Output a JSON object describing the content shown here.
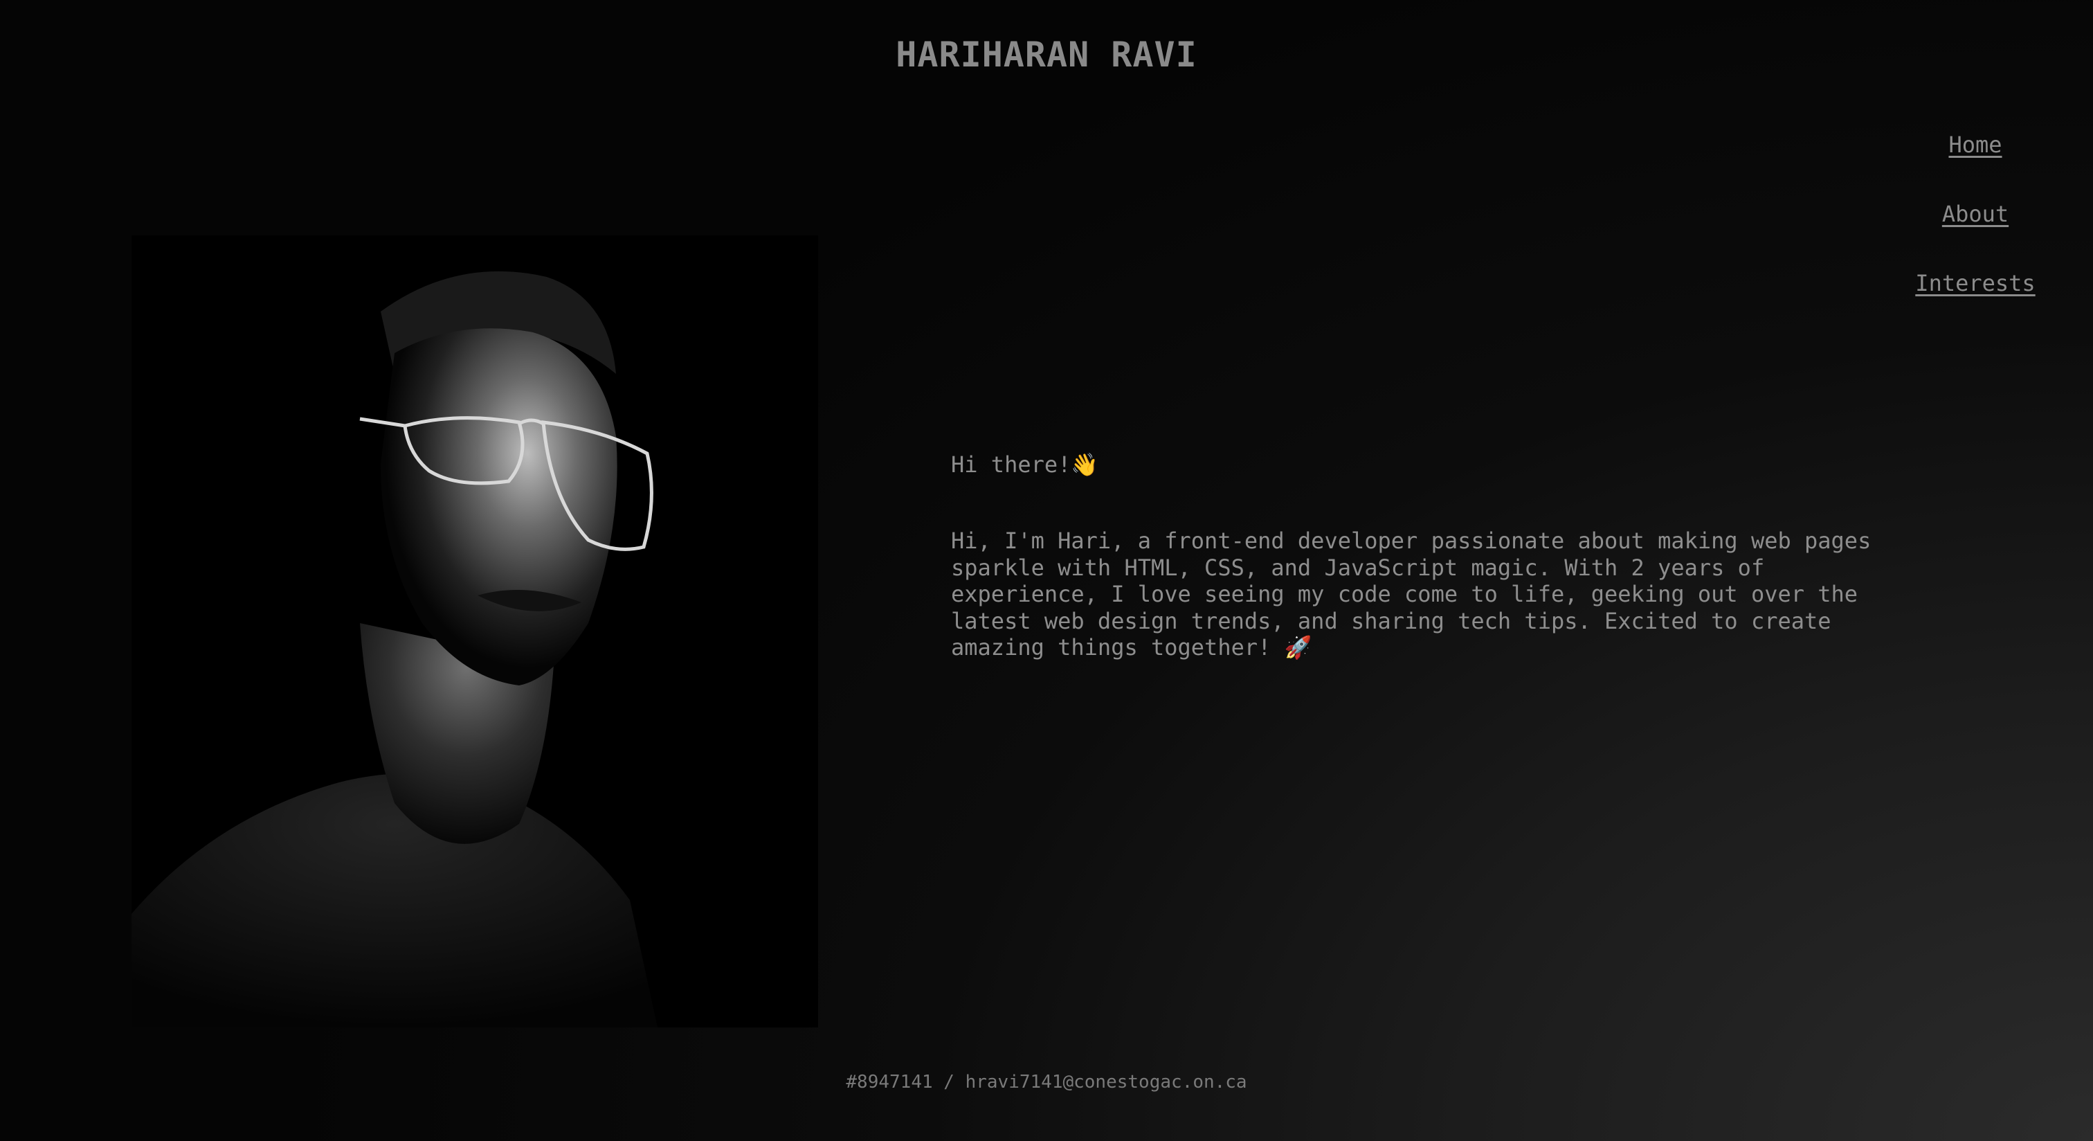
{
  "header": {
    "title": "HARIHARAN RAVI"
  },
  "nav": {
    "items": [
      {
        "label": "Home"
      },
      {
        "label": "About"
      },
      {
        "label": "Interests"
      }
    ]
  },
  "portrait": {
    "description_icon": "portrait-photo"
  },
  "intro": {
    "greeting": "Hi there!",
    "greeting_emoji": "👋",
    "bio": "Hi, I'm Hari, a front-end developer passionate about making web pages sparkle with HTML, CSS, and JavaScript magic. With 2 years of experience, I love seeing my code come to life, geeking out over the latest web design trends, and sharing tech tips. Excited to create amazing things together!",
    "bio_emoji": "🚀"
  },
  "footer": {
    "text": "#8947141 / hravi7141@conestogac.on.ca"
  },
  "colors": {
    "background_dark": "#050505",
    "background_light": "#2b2b2b",
    "text": "#8e8e8e"
  }
}
